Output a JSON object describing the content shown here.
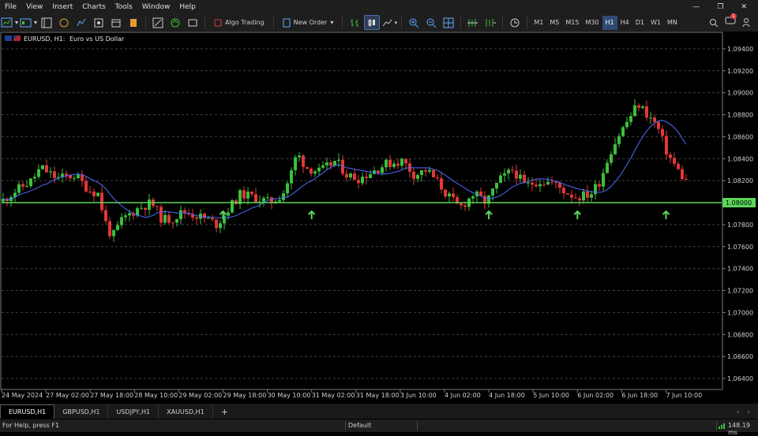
{
  "menu": [
    "File",
    "View",
    "Insert",
    "Charts",
    "Tools",
    "Window",
    "Help"
  ],
  "toolbar": {
    "algo_trading": "Algo Trading",
    "new_order": "New Order",
    "timeframes": [
      "M1",
      "M5",
      "M15",
      "M30",
      "H1",
      "H4",
      "D1",
      "W1",
      "MN"
    ],
    "active_timeframe": "H1",
    "notification_count": "1"
  },
  "chart": {
    "symbol_label": "EURUSD, H1:",
    "description": "Euro vs US Dollar",
    "price_levels": [
      "1.09400",
      "1.09200",
      "1.09000",
      "1.08800",
      "1.08600",
      "1.08400",
      "1.08200",
      "1.08000",
      "1.07800",
      "1.07600",
      "1.07400",
      "1.07200",
      "1.07000",
      "1.06800",
      "1.06600",
      "1.06400"
    ],
    "current_price_label": "1.08000",
    "time_labels": [
      "24 May 2024",
      "27 May 02:00",
      "27 May 18:00",
      "28 May 10:00",
      "29 May 02:00",
      "29 May 18:00",
      "30 May 10:00",
      "31 May 02:00",
      "31 May 18:00",
      "3 Jun 10:00",
      "4 Jun 02:00",
      "4 Jun 18:00",
      "5 Jun 10:00",
      "6 Jun 02:00",
      "6 Jun 18:00",
      "7 Jun 10:00"
    ],
    "colors": {
      "up": "#3cbf3c",
      "down": "#e03838",
      "ma": "#4d6bff",
      "level": "#5cd65c",
      "grid": "#404040"
    },
    "horizontal_level": 1.08,
    "price_axis_range": [
      1.063,
      1.0955
    ],
    "arrow_up_times": [
      "29 May 18:00",
      "31 May 02:00",
      "4 Jun 18:00",
      "6 Jun 02:00",
      "7 Jun 10:00"
    ]
  },
  "tabs": [
    "EURUSD,H1",
    "GBPUSD,H1",
    "USDJPY,H1",
    "XAUUSD,H1"
  ],
  "active_tab": "EURUSD,H1",
  "status": {
    "help": "For Help, press F1",
    "profile": "Default",
    "ping": "148.19 ms"
  }
}
